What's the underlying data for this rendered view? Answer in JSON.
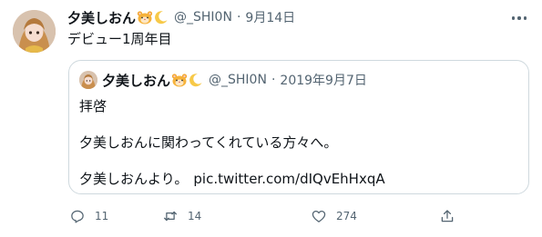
{
  "tweet": {
    "author_name": "夕美しおん",
    "author_handle": "@_SHI0N",
    "separator": "·",
    "date": "9月14日",
    "text": "デビュー1周年目",
    "emoji_icons": [
      "hamster-face-icon",
      "crescent-moon-icon"
    ]
  },
  "quote": {
    "author_name": "夕美しおん",
    "author_handle": "@_SHI0N",
    "separator": "·",
    "date": "2019年9月7日",
    "lines": [
      "拝啓",
      "夕美しおんに関わってくれている方々へ。",
      "夕美しおんより。"
    ],
    "link_text": "pic.twitter.com/dIQvEhHxqA"
  },
  "actions": {
    "reply_count": "11",
    "retweet_count": "14",
    "like_count": "274"
  },
  "colors": {
    "text_primary": "#0f1419",
    "text_secondary": "#536471",
    "border": "#cfd9de"
  }
}
